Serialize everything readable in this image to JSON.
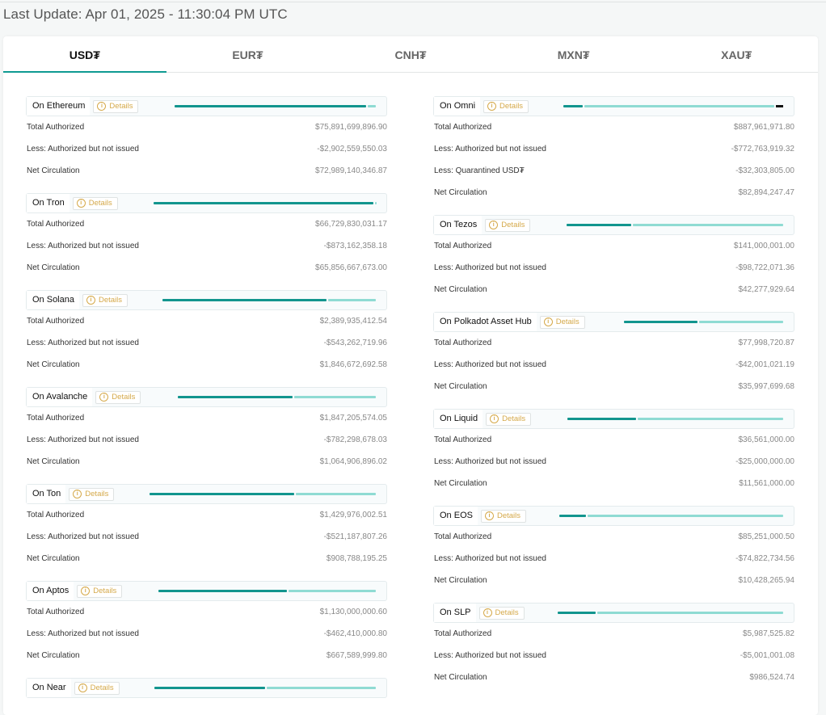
{
  "last_update": "Last Update: Apr 01, 2025 - 11:30:04 PM UTC",
  "tabs": [
    {
      "label": "USD₮",
      "active": true
    },
    {
      "label": "EUR₮",
      "active": false
    },
    {
      "label": "CNH₮",
      "active": false
    },
    {
      "label": "MXN₮",
      "active": false
    },
    {
      "label": "XAU₮",
      "active": false
    }
  ],
  "details_label": "Details",
  "icons": {
    "details": "info-icon"
  },
  "colors": {
    "issued": "#12958e",
    "unissued": "#8fdbd3",
    "quarantined": "#111111",
    "accent": "#0f9a92",
    "details": "#d5a94a"
  },
  "left": [
    {
      "chain": "On Ethereum",
      "share": [
        0.95,
        0.05
      ],
      "rows": [
        {
          "label": "Total Authorized",
          "value": "$75,891,699,896.90"
        },
        {
          "label": "Less: Authorized but not issued",
          "value": "-$2,902,559,550.03"
        },
        {
          "label": "Net Circulation",
          "value": "$72,989,140,346.87"
        }
      ]
    },
    {
      "chain": "On Tron",
      "share": [
        0.99,
        0.01
      ],
      "rows": [
        {
          "label": "Total Authorized",
          "value": "$66,729,830,031.17"
        },
        {
          "label": "Less: Authorized but not issued",
          "value": "-$873,162,358.18"
        },
        {
          "label": "Net Circulation",
          "value": "$65,856,667,673.00"
        }
      ]
    },
    {
      "chain": "On Solana",
      "share": [
        0.77,
        0.23
      ],
      "rows": [
        {
          "label": "Total Authorized",
          "value": "$2,389,935,412.54"
        },
        {
          "label": "Less: Authorized but not issued",
          "value": "-$543,262,719.96"
        },
        {
          "label": "Net Circulation",
          "value": "$1,846,672,692.58"
        }
      ]
    },
    {
      "chain": "On Avalanche",
      "share": [
        0.58,
        0.42
      ],
      "rows": [
        {
          "label": "Total Authorized",
          "value": "$1,847,205,574.05"
        },
        {
          "label": "Less: Authorized but not issued",
          "value": "-$782,298,678.03"
        },
        {
          "label": "Net Circulation",
          "value": "$1,064,906,896.02"
        }
      ]
    },
    {
      "chain": "On Ton",
      "share": [
        0.64,
        0.36
      ],
      "rows": [
        {
          "label": "Total Authorized",
          "value": "$1,429,976,002.51"
        },
        {
          "label": "Less: Authorized but not issued",
          "value": "-$521,187,807.26"
        },
        {
          "label": "Net Circulation",
          "value": "$908,788,195.25"
        }
      ]
    },
    {
      "chain": "On Aptos",
      "share": [
        0.59,
        0.41
      ],
      "rows": [
        {
          "label": "Total Authorized",
          "value": "$1,130,000,000.60"
        },
        {
          "label": "Less: Authorized but not issued",
          "value": "-$462,410,000.80"
        },
        {
          "label": "Net Circulation",
          "value": "$667,589,999.80"
        }
      ]
    },
    {
      "chain": "On Near",
      "share": [
        0.5,
        0.5
      ],
      "rows": []
    }
  ],
  "right": [
    {
      "chain": "On Omni",
      "share": [
        0.09,
        0.87,
        0.04
      ],
      "rows": [
        {
          "label": "Total Authorized",
          "value": "$887,961,971.80"
        },
        {
          "label": "Less: Authorized but not issued",
          "value": "-$772,763,919.32"
        },
        {
          "label": "Less: Quarantined USD₮",
          "value": "-$32,303,805.00"
        },
        {
          "label": "Net Circulation",
          "value": "$82,894,247.47"
        }
      ]
    },
    {
      "chain": "On Tezos",
      "share": [
        0.3,
        0.7
      ],
      "rows": [
        {
          "label": "Total Authorized",
          "value": "$141,000,001.00"
        },
        {
          "label": "Less: Authorized but not issued",
          "value": "-$98,722,071.36"
        },
        {
          "label": "Net Circulation",
          "value": "$42,277,929.64"
        }
      ]
    },
    {
      "chain": "On Polkadot Asset Hub",
      "share": [
        0.46,
        0.54
      ],
      "rows": [
        {
          "label": "Total Authorized",
          "value": "$77,998,720.87"
        },
        {
          "label": "Less: Authorized but not issued",
          "value": "-$42,001,021.19"
        },
        {
          "label": "Net Circulation",
          "value": "$35,997,699.68"
        }
      ]
    },
    {
      "chain": "On Liquid",
      "share": [
        0.32,
        0.68
      ],
      "rows": [
        {
          "label": "Total Authorized",
          "value": "$36,561,000.00"
        },
        {
          "label": "Less: Authorized but not issued",
          "value": "-$25,000,000.00"
        },
        {
          "label": "Net Circulation",
          "value": "$11,561,000.00"
        }
      ]
    },
    {
      "chain": "On EOS",
      "share": [
        0.12,
        0.88
      ],
      "rows": [
        {
          "label": "Total Authorized",
          "value": "$85,251,000.50"
        },
        {
          "label": "Less: Authorized but not issued",
          "value": "-$74,822,734.56"
        },
        {
          "label": "Net Circulation",
          "value": "$10,428,265.94"
        }
      ]
    },
    {
      "chain": "On SLP",
      "share": [
        0.17,
        0.83
      ],
      "rows": [
        {
          "label": "Total Authorized",
          "value": "$5,987,525.82"
        },
        {
          "label": "Less: Authorized but not issued",
          "value": "-$5,001,001.08"
        },
        {
          "label": "Net Circulation",
          "value": "$986,524.74"
        }
      ]
    }
  ]
}
